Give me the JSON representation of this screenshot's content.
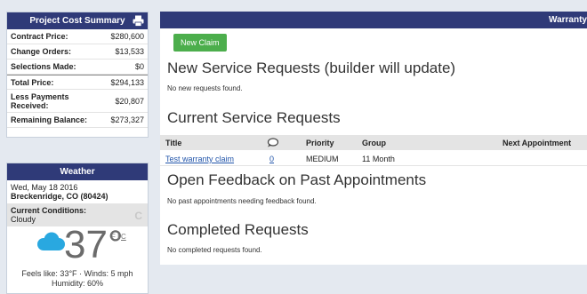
{
  "cost_summary": {
    "title": "Project Cost Summary",
    "rows": [
      {
        "label": "Contract Price:",
        "value": "$280,600"
      },
      {
        "label": "Change Orders:",
        "value": "$13,533"
      },
      {
        "label": "Selections Made:",
        "value": "$0"
      },
      {
        "label": "Total Price:",
        "value": "$294,133"
      },
      {
        "label": "Less Payments Received:",
        "value": "$20,807"
      },
      {
        "label": "Remaining Balance:",
        "value": "$273,327"
      }
    ]
  },
  "weather": {
    "title": "Weather",
    "date": "Wed, May 18 2016",
    "location": "Breckenridge, CO (80424)",
    "conditions_label": "Current Conditions:",
    "conditions_value": "Cloudy",
    "temperature": "37°",
    "unit_f": "F",
    "unit_sep": "|",
    "unit_c": "C",
    "feels_line": "Feels like: 33°F · Winds: 5 mph",
    "humidity_line": "Humidity: 60%"
  },
  "main": {
    "header_title": "Warranty",
    "new_claim_label": "New Claim",
    "new_requests_title": "New Service Requests (builder will update)",
    "new_requests_msg": "No new requests found.",
    "current_title": "Current Service Requests",
    "table": {
      "headers": {
        "title": "Title",
        "priority": "Priority",
        "group": "Group",
        "next": "Next Appointment"
      },
      "rows": [
        {
          "title": "Test warranty claim",
          "comments": "0",
          "priority": "MEDIUM",
          "group": "11 Month",
          "next": ""
        }
      ]
    },
    "feedback_title": "Open Feedback on Past Appointments",
    "feedback_msg": "No past appointments needing feedback found.",
    "completed_title": "Completed Requests",
    "completed_msg": "No completed requests found."
  },
  "colors": {
    "header_bg": "#2f3a78",
    "button_green": "#4cae4c",
    "link_blue": "#2255aa",
    "cloud_blue": "#29a8e0"
  }
}
